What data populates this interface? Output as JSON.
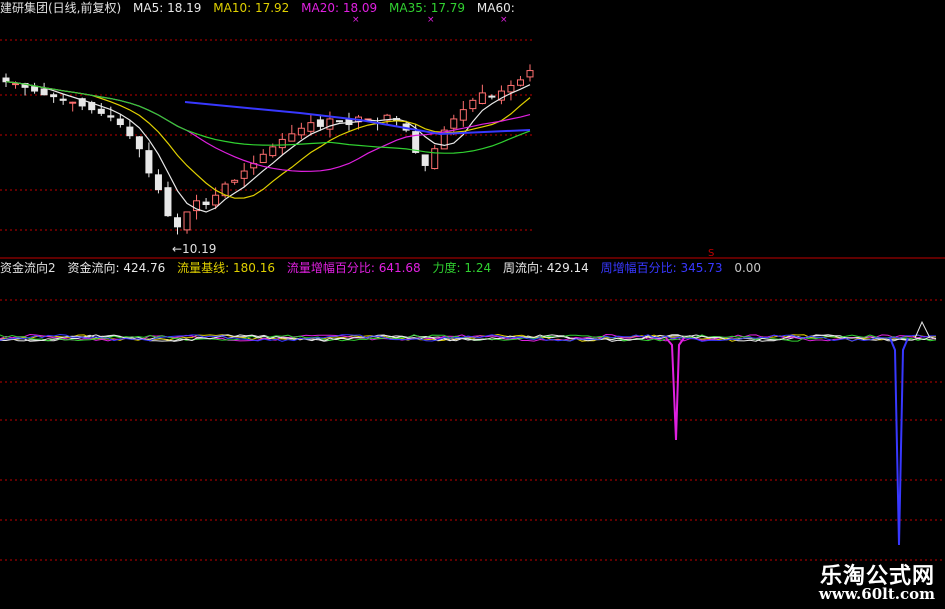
{
  "colors": {
    "white": "#e8e8e8",
    "yellow": "#e0d000",
    "magenta": "#e020e0",
    "green": "#30d030",
    "blue": "#3838ff",
    "red": "#c00000",
    "lightred": "#ff7070"
  },
  "price_header": {
    "title": "建研集团(日线,前复权)",
    "ma5": "MA5: 18.19",
    "ma10": "MA10: 17.92",
    "ma20": "MA20: 18.09",
    "ma35": "MA35: 17.79",
    "ma60": "MA60:"
  },
  "low_label": "←10.19",
  "indicator_header": {
    "name": "资金流向2",
    "flow": "资金流向: 424.76",
    "baseline": "流量基线: 180.16",
    "pct": "流量增幅百分比: 641.68",
    "force": "力度: 1.24",
    "weekly": "周流向: 429.14",
    "weekly_pct": "周增幅百分比: 345.73",
    "zero": "0.00"
  },
  "watermark": {
    "name": "乐淘公式网",
    "url": "www.60lt.com"
  },
  "chart_data": {
    "type": "candlestick",
    "price_closes": [
      18.4,
      18.3,
      18.1,
      17.9,
      17.7,
      17.6,
      17.4,
      17.3,
      17.1,
      16.9,
      16.7,
      16.5,
      16.1,
      15.5,
      14.8,
      13.5,
      12.6,
      11.2,
      10.6,
      11.4,
      12.0,
      11.8,
      12.3,
      12.9,
      13.1,
      13.6,
      14.0,
      14.5,
      14.9,
      15.3,
      15.6,
      15.9,
      16.2,
      16.0,
      16.4,
      16.3,
      16.1,
      16.5,
      16.4,
      16.2,
      16.6,
      16.3,
      15.8,
      14.6,
      13.9,
      14.8,
      15.8,
      16.4,
      16.9,
      17.4,
      17.8,
      17.6,
      17.9,
      18.2,
      18.5,
      19.0
    ],
    "price_low": 10.19,
    "indicator_lines": [
      "资金流向",
      "流量基线",
      "流量增幅百分比",
      "力度",
      "周流向",
      "周增幅百分比"
    ]
  }
}
